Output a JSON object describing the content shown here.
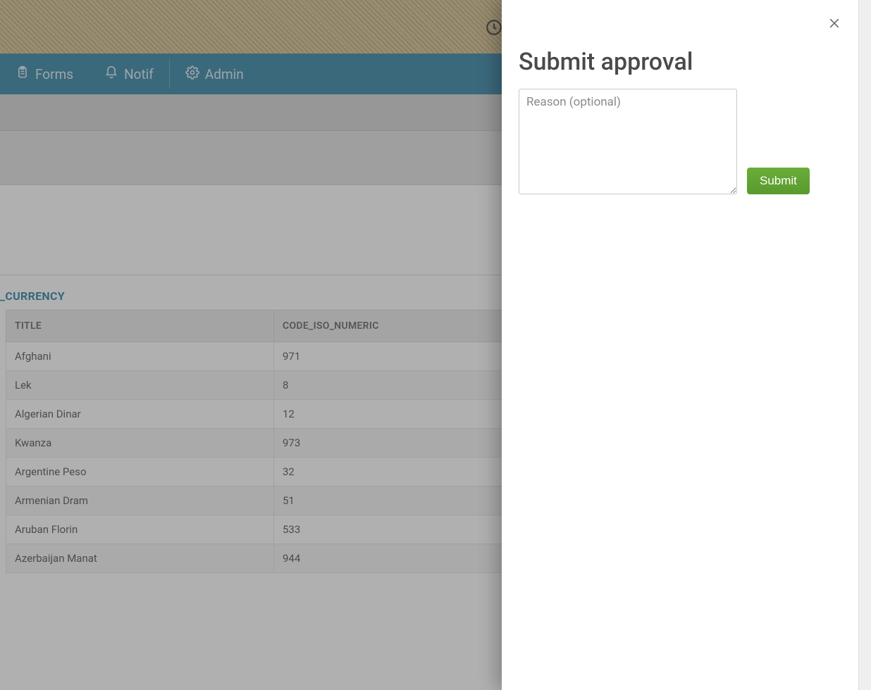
{
  "nav": {
    "forms": "Forms",
    "notif": "Notif",
    "admin": "Admin"
  },
  "sectionLabel": "_CURRENCY",
  "table": {
    "headers": {
      "title": "TITLE",
      "code": "CODE_ISO_NUMERIC"
    },
    "rows": [
      {
        "title": "Afghani",
        "code": "971"
      },
      {
        "title": "Lek",
        "code": "8"
      },
      {
        "title": "Algerian Dinar",
        "code": "12"
      },
      {
        "title": "Kwanza",
        "code": "973"
      },
      {
        "title": "Argentine Peso",
        "code": "32"
      },
      {
        "title": "Armenian Dram",
        "code": "51"
      },
      {
        "title": "Aruban Florin",
        "code": "533"
      },
      {
        "title": "Azerbaijan Manat",
        "code": "944"
      }
    ]
  },
  "panel": {
    "title": "Submit approval",
    "reasonPlaceholder": "Reason (optional)",
    "submitLabel": "Submit"
  }
}
